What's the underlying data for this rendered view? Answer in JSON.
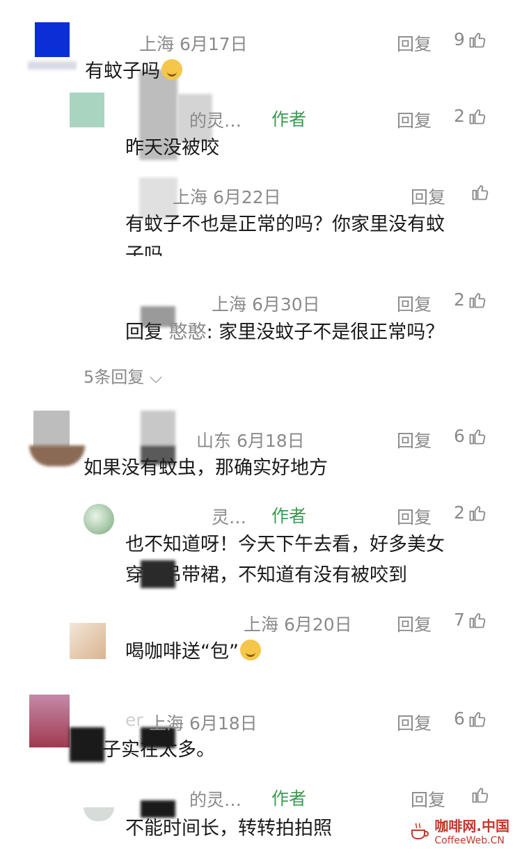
{
  "colors": {
    "author": "#3a9a4f",
    "meta": "#8a8a8a",
    "text": "#1a1a1a",
    "watermark": "#c0392b"
  },
  "comments": [
    {
      "meta": "上海 6月17日",
      "reply": "回复",
      "likes": "9",
      "text": "有蚊子吗"
    },
    {
      "name": "的灵…",
      "author": "作者",
      "reply": "回复",
      "likes": "2",
      "text": "昨天没被咬"
    },
    {
      "meta": "上海 6月22日",
      "reply": "回复",
      "likes": "",
      "text1": "有蚊子不也是正常的吗？你家里没有蚊",
      "text2": "子吗"
    },
    {
      "meta": "上海 6月30日",
      "reply": "回复",
      "likes": "2",
      "reply_prefix": "回复",
      "mention": "憨憨",
      "text": ": 家里没蚊子不是很正常吗？"
    },
    {
      "more": "5条回复"
    },
    {
      "meta": "山东 6月18日",
      "reply": "回复",
      "likes": "6",
      "text": "如果没有蚊虫，那确实好地方"
    },
    {
      "name": "灵…",
      "author": "作者",
      "reply": "回复",
      "likes": "2",
      "text1": "也不知道呀！今天下午去看，好多美女",
      "text2": "穿着吊带裙，不知道有没有被咬到"
    },
    {
      "meta": "上海 6月20日",
      "reply": "回复",
      "likes": "7",
      "text": "喝咖啡送“包”"
    },
    {
      "meta": "上海 6月18日",
      "name_tail": "er",
      "reply": "回复",
      "likes": "6",
      "text": "蚊子实在太多。"
    },
    {
      "name": "的灵…",
      "author": "作者",
      "reply": "回复",
      "likes": "",
      "text": "不能时间长，转转拍拍照"
    }
  ],
  "watermark": {
    "cn": "咖啡网.中国",
    "en": "CoffeeWeb.CN"
  }
}
